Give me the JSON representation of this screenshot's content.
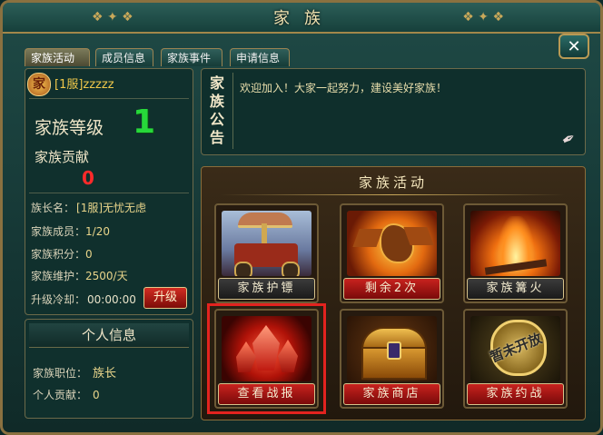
{
  "window": {
    "title": "家族",
    "close_icon": "close-icon"
  },
  "tabs": [
    {
      "label": "家族活动",
      "active": true
    },
    {
      "label": "成员信息",
      "active": false
    },
    {
      "label": "家族事件",
      "active": false
    },
    {
      "label": "申请信息",
      "active": false
    }
  ],
  "family": {
    "badge_icon": "family-emblem-icon",
    "name": "[1服]zzzzz",
    "level_label": "家族等级",
    "level_value": "1",
    "contribution_label": "家族贡献",
    "contribution_value": "0",
    "stats": [
      {
        "label": "族长名：",
        "value": "[1服]无忧无虑"
      },
      {
        "label": "家族成员：",
        "value": "1/20"
      },
      {
        "label": "家族积分：",
        "value": "0"
      },
      {
        "label": "家族维护：",
        "value": "2500/天"
      },
      {
        "label": "升级冷却：",
        "value": "00:00:00"
      }
    ],
    "upgrade_button": "升级"
  },
  "personal": {
    "title": "个人信息",
    "position_label": "家族职位：",
    "position_value": "族长",
    "contribution_label": "个人贡献：",
    "contribution_value": "0"
  },
  "notice": {
    "title": "家族公告",
    "text": "欢迎加入！大家一起努力，建设美好家族！",
    "edit_icon": "quill-pen-icon"
  },
  "activities": {
    "title": "家族活动",
    "cards": [
      {
        "label": "家族护镖",
        "style": "dark",
        "icon": "escort-carriage-icon",
        "highlighted": false
      },
      {
        "label": "剩余2次",
        "style": "red",
        "icon": "fire-dragon-icon",
        "highlighted": false
      },
      {
        "label": "家族篝火",
        "style": "dark",
        "icon": "bonfire-icon",
        "highlighted": false
      },
      {
        "label": "查看战报",
        "style": "red",
        "icon": "red-crystal-icon",
        "highlighted": true
      },
      {
        "label": "家族商店",
        "style": "red",
        "icon": "treasure-chest-icon",
        "highlighted": false
      },
      {
        "label": "家族约战",
        "style": "red",
        "icon": "shield-medal-icon",
        "highlighted": false,
        "stamp": "暂未开放"
      }
    ]
  },
  "colors": {
    "accent_gold": "#c9a85a",
    "level_green": "#27d83a",
    "contribution_red": "#ff2a2a",
    "highlight_red": "#e3231f"
  }
}
